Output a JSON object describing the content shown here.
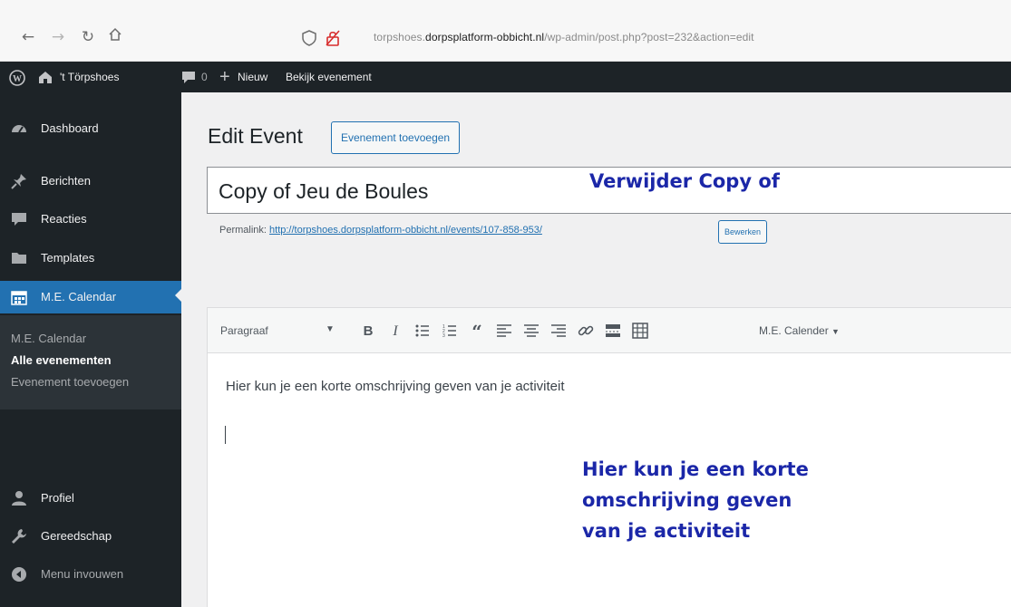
{
  "browser": {
    "url_prefix": "torpshoes.",
    "url_domain": "dorpsplatform-obbicht.nl",
    "url_path": "/wp-admin/post.php?post=232&action=edit"
  },
  "admin_bar": {
    "site_name": "'t Törpshoes",
    "comments_count": "0",
    "new_label": "Nieuw",
    "view_label": "Bekijk evenement"
  },
  "sidebar": {
    "items": [
      {
        "label": "Dashboard",
        "icon": "dashboard-icon"
      },
      {
        "label": "Berichten",
        "icon": "pin-icon"
      },
      {
        "label": "Reacties",
        "icon": "comment-icon"
      },
      {
        "label": "Templates",
        "icon": "folder-icon"
      },
      {
        "label": "M.E. Calendar",
        "icon": "calendar-icon"
      },
      {
        "label": "Profiel",
        "icon": "user-icon"
      },
      {
        "label": "Gereedschap",
        "icon": "wrench-icon"
      },
      {
        "label": "Menu invouwen",
        "icon": "collapse-icon"
      }
    ],
    "submenu": [
      "M.E. Calendar",
      "Alle evenementen",
      "Evenement toevoegen"
    ]
  },
  "main": {
    "page_title": "Edit Event",
    "add_new_label": "Evenement toevoegen",
    "title_value": "Copy of Jeu de Boules",
    "permalink_label": "Permalink:",
    "permalink_url": "http://torpshoes.dorpsplatform-obbicht.nl/events/107-858-953/",
    "edit_slug_label": "Bewerken",
    "format_value": "Paragraaf",
    "calendar_dropdown": "M.E. Calender",
    "editor_content": "Hier kun je een korte omschrijving geven van je activiteit"
  },
  "annotations": {
    "title_note": "Verwijder Copy of",
    "content_note_lines": [
      "Hier kun je een korte",
      "omschrijving geven",
      "van je activiteit"
    ],
    "color": "#1b27a8"
  },
  "colors": {
    "admin_bg": "#1d2327",
    "active_blue": "#2271b1",
    "submenu_bg": "#2c3338"
  }
}
